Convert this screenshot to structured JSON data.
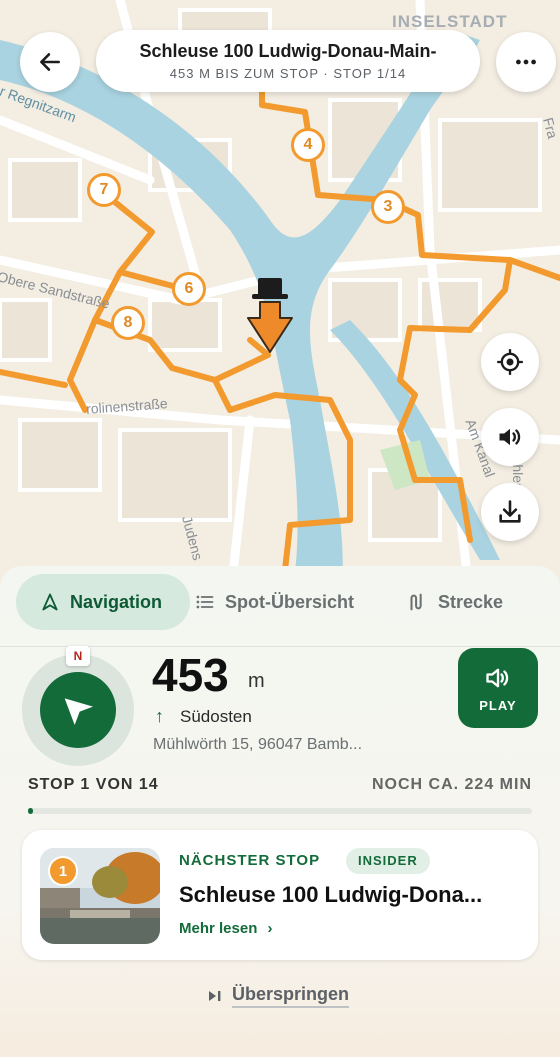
{
  "header": {
    "title": "Schleuse 100 Ludwig-Donau-Main-",
    "subtitle": "453 M BIS ZUM STOP · STOP 1/14",
    "back_icon": "arrow-left-icon",
    "more_icon": "more-horizontal-icon"
  },
  "map": {
    "district_label": "INSELSTADT",
    "street_labels": [
      "r Regnitzarm",
      "Obere Sandstraße",
      "rolinenstraße",
      "Am Kanal",
      "Judens",
      "Schleuse",
      "Fra"
    ],
    "stop_markers": [
      "4",
      "3",
      "7",
      "6",
      "8"
    ],
    "route_color": "#f29a2e",
    "water_color": "#a9d3e0",
    "fab_icons": [
      "locate-icon",
      "sound-icon",
      "download-icon"
    ]
  },
  "tabs": [
    {
      "label": "Navigation",
      "icon": "navigation-arrow-icon",
      "active": true
    },
    {
      "label": "Spot-Übersicht",
      "icon": "list-icon",
      "active": false
    },
    {
      "label": "Strecke",
      "icon": "route-icon",
      "active": false
    }
  ],
  "navigation": {
    "compass_label": "N",
    "distance_value": "453",
    "distance_unit": "m",
    "direction_arrow": "↑",
    "direction": "Südosten",
    "address": "Mühlwörth 15, 96047 Bamb...",
    "play_label": "PLAY"
  },
  "progress": {
    "stop_text": "STOP 1 VON 14",
    "remaining_text": "NOCH CA. 224 MIN",
    "fraction": 0.01
  },
  "next_stop": {
    "badge_number": "1",
    "label": "NÄCHSTER STOP",
    "tag": "INSIDER",
    "title": "Schleuse 100 Ludwig-Dona...",
    "more_label": "Mehr lesen"
  },
  "skip_label": "Überspringen",
  "colors": {
    "primary_green": "#146b3a",
    "accent_orange": "#f29a2e"
  }
}
